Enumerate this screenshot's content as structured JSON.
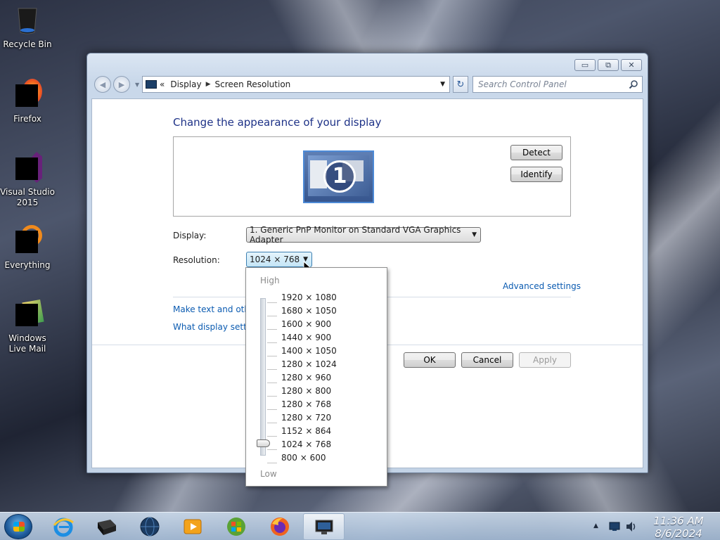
{
  "desktop": {
    "icons": [
      {
        "label": "Recycle Bin",
        "icon": "recycle-bin-icon"
      },
      {
        "label": "Firefox",
        "icon": "firefox-icon"
      },
      {
        "label": "Visual Studio 2015",
        "icon": "visual-studio-icon"
      },
      {
        "label": "Everything",
        "icon": "everything-icon"
      },
      {
        "label": "Windows Live Mail",
        "icon": "windows-live-mail-icon"
      }
    ]
  },
  "window": {
    "controls": {
      "minimize": "▭",
      "maximize": "⧉",
      "close": "✕"
    },
    "nav": {
      "back": "◀",
      "forward": "▶",
      "dropdown": "▼"
    },
    "address": {
      "prefix": "«",
      "crumbs": [
        "Display",
        "Screen Resolution"
      ],
      "sep": "▶",
      "arrow": "▼"
    },
    "refresh": "↻",
    "search_placeholder": "Search Control Panel"
  },
  "main": {
    "heading": "Change the appearance of your display",
    "monitor_number": "1",
    "detect_label": "Detect",
    "identify_label": "Identify",
    "display_label": "Display:",
    "display_value": "1. Generic PnP Monitor on Standard VGA Graphics Adapter",
    "resolution_label": "Resolution:",
    "resolution_value": "1024 × 768",
    "advanced_link": "Advanced settings",
    "link_text_size": "Make text and other",
    "link_display_settings": "What display setting",
    "ok_label": "OK",
    "cancel_label": "Cancel",
    "apply_label": "Apply"
  },
  "resolution_dropdown": {
    "high_label": "High",
    "low_label": "Low",
    "options": [
      "1920 × 1080",
      "1680 × 1050",
      "1600 × 900",
      "1440 × 900",
      "1400 × 1050",
      "1280 × 1024",
      "1280 × 960",
      "1280 × 800",
      "1280 × 768",
      "1280 × 720",
      "1152 × 864",
      "1024 × 768",
      "800 × 600"
    ],
    "selected": "1024 × 768"
  },
  "taskbar": {
    "pinned": [
      "internet-explorer-icon",
      "terminal-icon",
      "network-globe-icon",
      "media-player-icon",
      "windows-update-icon",
      "firefox-icon",
      "display-settings-icon"
    ],
    "tray_up": "▲",
    "time": "11:36 AM",
    "date": "8/6/2024"
  },
  "colors": {
    "heading": "#1e3287",
    "link": "#0b5bb1",
    "taskbar": "#b4c8de"
  }
}
